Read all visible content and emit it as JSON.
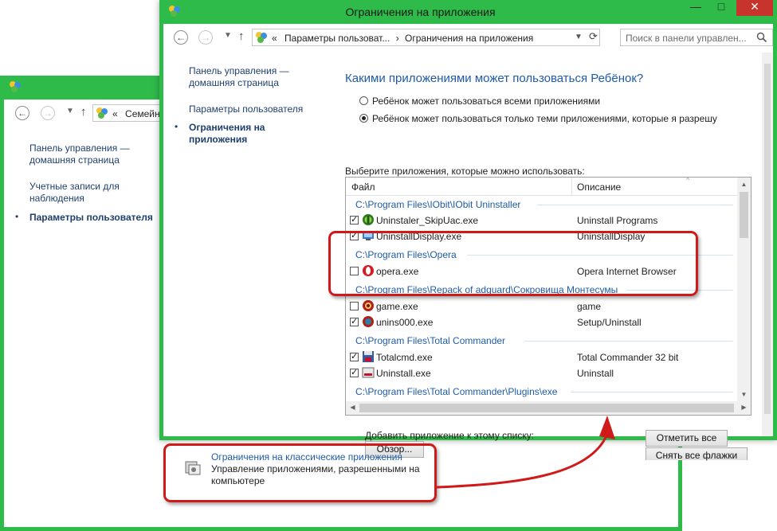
{
  "back_window": {
    "address_path": "Семейн",
    "address_prefix": "«",
    "nav": [
      {
        "label": "Панель управления —\nдомашняя страница"
      },
      {
        "label": "Учетные записи для\nнаблюдения"
      },
      {
        "label": "Параметры пользователя"
      }
    ]
  },
  "front_window": {
    "title": "Ограничения на приложения",
    "caption": {
      "minimize": "—",
      "maximize": "□",
      "close": "✕"
    },
    "address": {
      "prefix": "«",
      "crumb1": "Параметры пользоват...",
      "sep": "›",
      "crumb2": "Ограничения на приложения"
    },
    "search_placeholder": "Поиск в панели управлен...",
    "nav": [
      {
        "label": "Панель управления —\nдомашняя страница"
      },
      {
        "label": "Параметры пользователя"
      },
      {
        "label": "Ограничения на\nприложения"
      }
    ],
    "heading": "Какими приложениями может пользоваться Ребёнок?",
    "radio_all": "Ребёнок может пользоваться всеми приложениями",
    "radio_only": "Ребёнок может пользоваться только теми приложениями, которые я разрешу",
    "list_caption": "Выберите приложения, которые можно использовать:",
    "col_file": "Файл",
    "col_desc": "Описание",
    "groups": {
      "iobit": "C:\\Program Files\\IObit\\IObit Uninstaller",
      "opera": "C:\\Program Files\\Opera",
      "repack": "C:\\Program Files\\Repack of adguard\\Сокровища Монтесумы",
      "tc": "C:\\Program Files\\Total Commander",
      "tcplugins": "C:\\Program Files\\Total Commander\\Plugins\\exe"
    },
    "rows": [
      {
        "file": "Uninstaler_SkipUac.exe",
        "desc": "Uninstall Programs",
        "checked": true
      },
      {
        "file": "UninstallDisplay.exe",
        "desc": "UninstallDisplay",
        "checked": true
      },
      {
        "file": "opera.exe",
        "desc": "Opera Internet Browser",
        "checked": false
      },
      {
        "file": "game.exe",
        "desc": "game",
        "checked": false
      },
      {
        "file": "unins000.exe",
        "desc": "Setup/Uninstall",
        "checked": true
      },
      {
        "file": "Totalcmd.exe",
        "desc": "Total Commander 32 bit",
        "checked": true
      },
      {
        "file": "Uninstall.exe",
        "desc": "Uninstall",
        "checked": true
      }
    ],
    "add_label": "Добавить приложение к этому списку:",
    "browse_btn": "Обзор...",
    "check_all_btn": "Отметить все",
    "uncheck_all_btn": "Снять все флажки"
  },
  "classic": {
    "title": "Ограничения на классические приложения",
    "desc": "Управление приложениями, разрешенными на компьютере"
  },
  "colors": {
    "frame": "#2fbb4a",
    "accent": "#1e5ba8",
    "highlight": "#d01919",
    "close": "#c7342d"
  }
}
